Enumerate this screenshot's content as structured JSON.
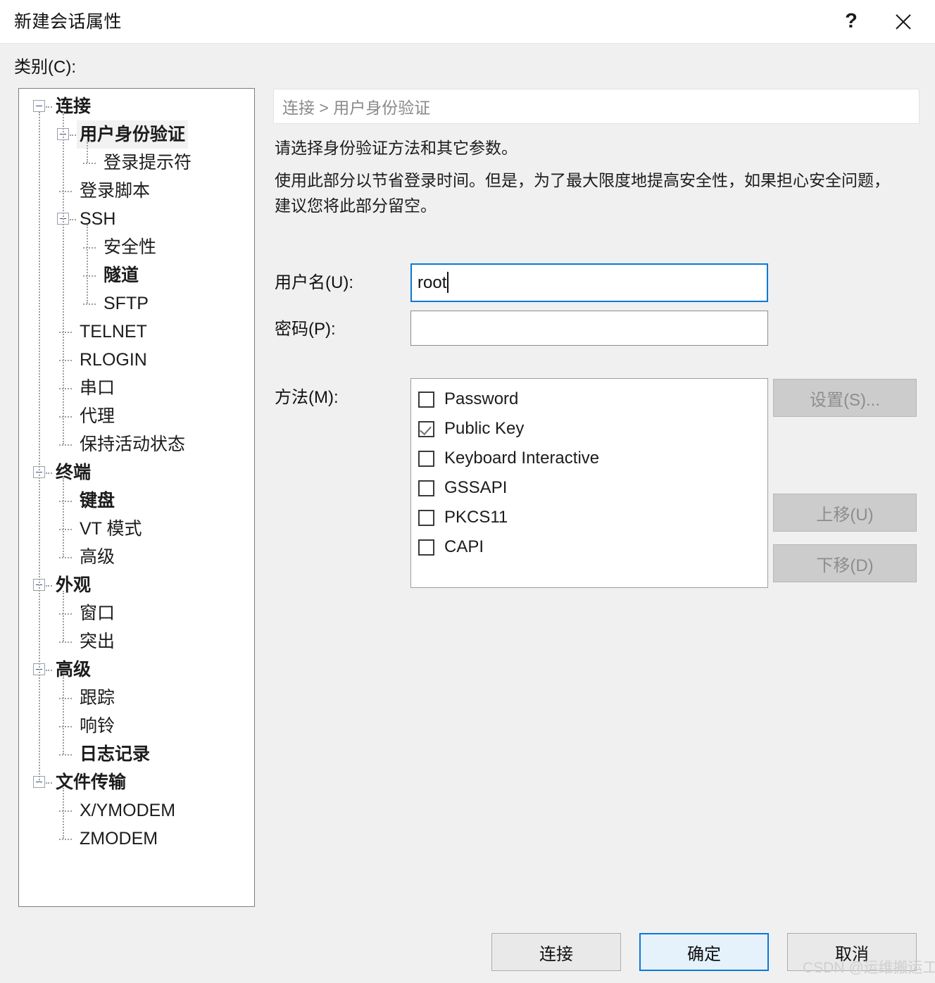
{
  "window": {
    "title": "新建会话属性",
    "help_icon": "question-mark-icon",
    "close_icon": "close-icon"
  },
  "category": {
    "label": "类别(C):",
    "tree": [
      {
        "label": "连接",
        "level": 0,
        "bold": true,
        "expanded": true,
        "selected": false
      },
      {
        "label": "用户身份验证",
        "level": 1,
        "bold": true,
        "expanded": true,
        "selected": true
      },
      {
        "label": "登录提示符",
        "level": 2,
        "bold": false,
        "expanded": null,
        "selected": false
      },
      {
        "label": "登录脚本",
        "level": 1,
        "bold": false,
        "expanded": null,
        "selected": false
      },
      {
        "label": "SSH",
        "level": 1,
        "bold": false,
        "expanded": true,
        "selected": false
      },
      {
        "label": "安全性",
        "level": 2,
        "bold": false,
        "expanded": null,
        "selected": false
      },
      {
        "label": "隧道",
        "level": 2,
        "bold": true,
        "expanded": null,
        "selected": false
      },
      {
        "label": "SFTP",
        "level": 2,
        "bold": false,
        "expanded": null,
        "selected": false
      },
      {
        "label": "TELNET",
        "level": 1,
        "bold": false,
        "expanded": null,
        "selected": false
      },
      {
        "label": "RLOGIN",
        "level": 1,
        "bold": false,
        "expanded": null,
        "selected": false
      },
      {
        "label": "串口",
        "level": 1,
        "bold": false,
        "expanded": null,
        "selected": false
      },
      {
        "label": "代理",
        "level": 1,
        "bold": false,
        "expanded": null,
        "selected": false
      },
      {
        "label": "保持活动状态",
        "level": 1,
        "bold": false,
        "expanded": null,
        "selected": false
      },
      {
        "label": "终端",
        "level": 0,
        "bold": true,
        "expanded": true,
        "selected": false
      },
      {
        "label": "键盘",
        "level": 1,
        "bold": true,
        "expanded": null,
        "selected": false
      },
      {
        "label": "VT 模式",
        "level": 1,
        "bold": false,
        "expanded": null,
        "selected": false
      },
      {
        "label": "高级",
        "level": 1,
        "bold": false,
        "expanded": null,
        "selected": false
      },
      {
        "label": "外观",
        "level": 0,
        "bold": true,
        "expanded": true,
        "selected": false
      },
      {
        "label": "窗口",
        "level": 1,
        "bold": false,
        "expanded": null,
        "selected": false
      },
      {
        "label": "突出",
        "level": 1,
        "bold": false,
        "expanded": null,
        "selected": false
      },
      {
        "label": "高级",
        "level": 0,
        "bold": true,
        "expanded": true,
        "selected": false
      },
      {
        "label": "跟踪",
        "level": 1,
        "bold": false,
        "expanded": null,
        "selected": false
      },
      {
        "label": "响铃",
        "level": 1,
        "bold": false,
        "expanded": null,
        "selected": false
      },
      {
        "label": "日志记录",
        "level": 1,
        "bold": true,
        "expanded": null,
        "selected": false
      },
      {
        "label": "文件传输",
        "level": 0,
        "bold": true,
        "expanded": true,
        "selected": false
      },
      {
        "label": "X/YMODEM",
        "level": 1,
        "bold": false,
        "expanded": null,
        "selected": false
      },
      {
        "label": "ZMODEM",
        "level": 1,
        "bold": false,
        "expanded": null,
        "selected": false
      }
    ]
  },
  "panel": {
    "breadcrumb": "连接  >  用户身份验证",
    "desc_line_1": "请选择身份验证方法和其它参数。",
    "desc_line_2": "使用此部分以节省登录时间。但是，为了最大限度地提高安全性，如果担心安全问题，",
    "desc_line_3": "建议您将此部分留空。",
    "username": {
      "label": "用户名(U):",
      "value": "root",
      "placeholder": ""
    },
    "password": {
      "label": "密码(P):",
      "value": "",
      "placeholder": ""
    },
    "methods": {
      "label": "方法(M):",
      "items": [
        {
          "label": "Password",
          "checked": false
        },
        {
          "label": "Public Key",
          "checked": true
        },
        {
          "label": "Keyboard Interactive",
          "checked": false
        },
        {
          "label": "GSSAPI",
          "checked": false
        },
        {
          "label": "PKCS11",
          "checked": false
        },
        {
          "label": "CAPI",
          "checked": false
        }
      ]
    },
    "side_buttons": {
      "settings": "设置(S)...",
      "move_up": "上移(U)",
      "move_down": "下移(D)"
    }
  },
  "footer": {
    "connect": "连接",
    "ok": "确定",
    "cancel": "取消"
  },
  "watermark": "CSDN @运维搬运工",
  "colors": {
    "accent": "#0a79d6",
    "dialog_bg": "#f0f0f0",
    "panel_bg": "#ffffff",
    "disabled_btn": "#cccccc"
  }
}
